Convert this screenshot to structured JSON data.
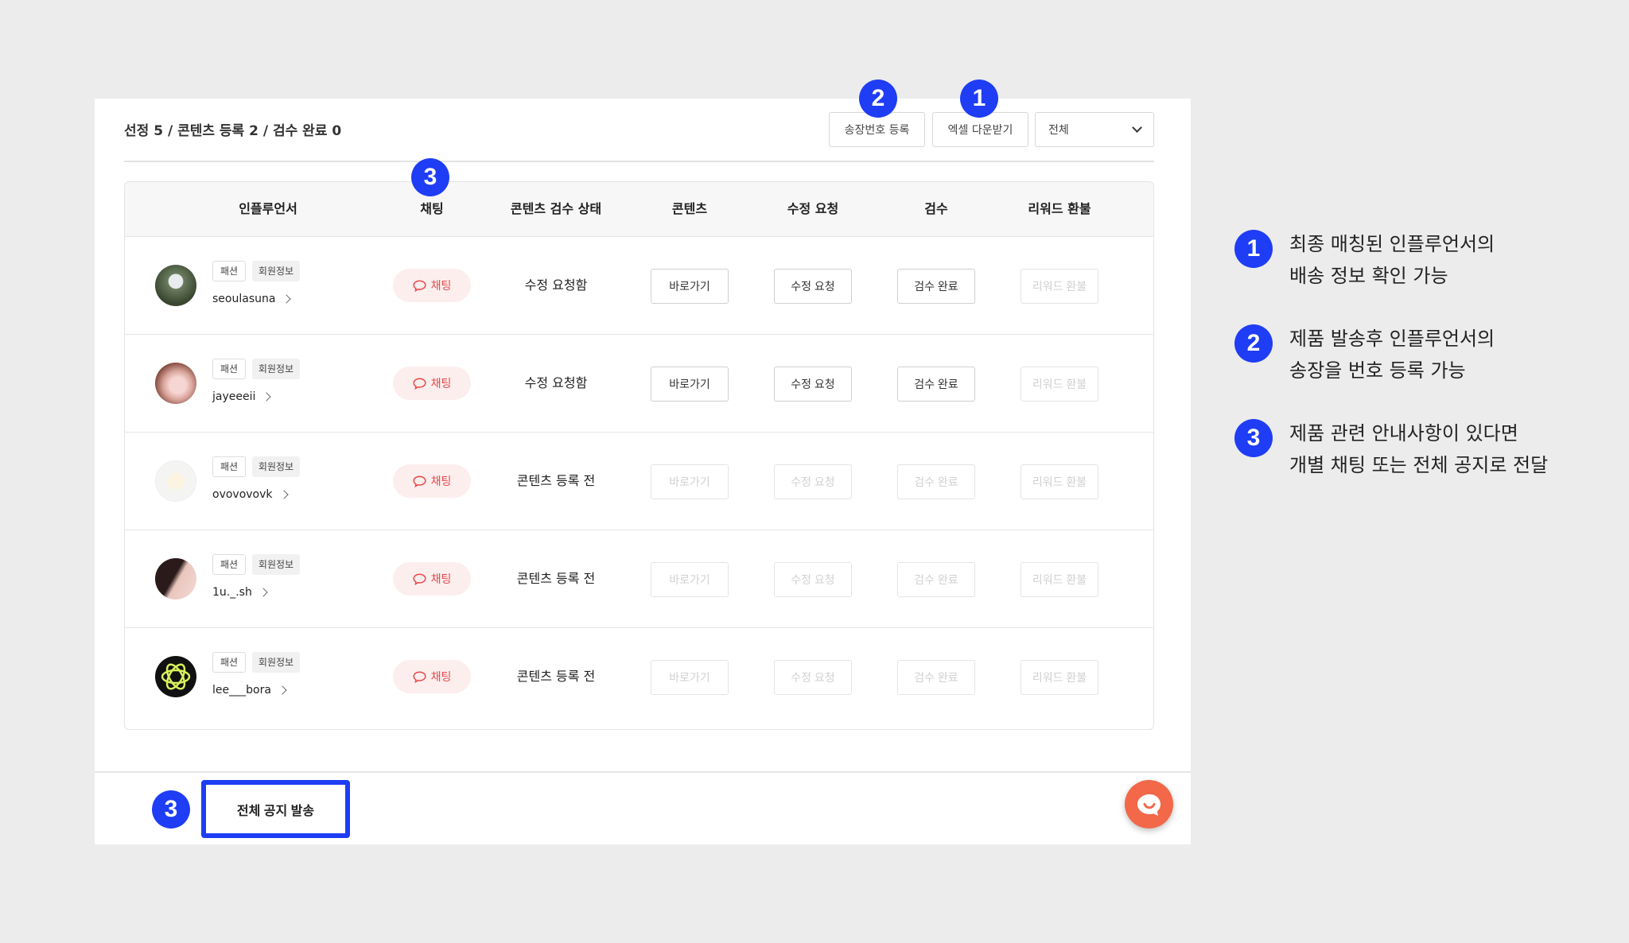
{
  "summary": "선정 5 / 콘텐츠 등록 2 / 검수 완료 0",
  "toolbar": {
    "invoice_label": "송장번호 등록",
    "excel_label": "엑셀 다운받기",
    "filter_value": "전체"
  },
  "columns": [
    "인플루언서",
    "채팅",
    "콘텐츠 검수 상태",
    "콘텐츠",
    "수정 요청",
    "검수",
    "리워드 환불"
  ],
  "tags": {
    "category": "패션",
    "member_info": "회원정보"
  },
  "chat_label": "채팅",
  "actions": {
    "go": "바로가기",
    "revise": "수정 요청",
    "done": "검수 완료",
    "refund": "리워드 환불"
  },
  "rows": [
    {
      "username": "seoulasuna",
      "status": "수정 요청함",
      "enabled": true
    },
    {
      "username": "jayeeeii",
      "status": "수정 요청함",
      "enabled": true
    },
    {
      "username": "ovovovovk",
      "status": "콘텐츠 등록 전",
      "enabled": false
    },
    {
      "username": "1u._.sh",
      "status": "콘텐츠 등록 전",
      "enabled": false
    },
    {
      "username": "lee___bora",
      "status": "콘텐츠 등록 전",
      "enabled": false
    }
  ],
  "footer": {
    "notice_label": "전체 공지 발송"
  },
  "badges": {
    "one": "1",
    "two": "2",
    "three": "3"
  },
  "legend": [
    {
      "num": "1",
      "line1": "최종 매칭된 인플루언서의",
      "line2": "배송 정보 확인 가능"
    },
    {
      "num": "2",
      "line1": "제품 발송후 인플루언서의",
      "line2": "송장을 번호 등록 가능"
    },
    {
      "num": "3",
      "line1": "제품 관련 안내사항이 있다면",
      "line2": "개별 채팅 또는 전체 공지로 전달"
    }
  ],
  "colors": {
    "accent": "#1f3df5",
    "chat": "#e94a4a",
    "fab": "#f26849"
  }
}
